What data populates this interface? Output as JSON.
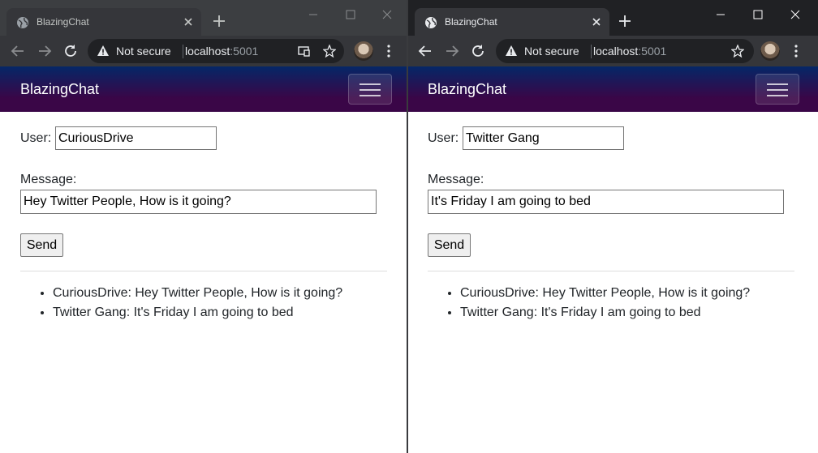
{
  "left_window": {
    "tab_title": "BlazingChat",
    "address": {
      "security_label": "Not secure",
      "host": "localhost",
      "port": ":5001"
    },
    "page": {
      "brand": "BlazingChat",
      "user_label": "User:",
      "user_value": "CuriousDrive",
      "message_label": "Message:",
      "message_value": "Hey Twitter People, How is it going?",
      "send_label": "Send",
      "messages": [
        "CuriousDrive: Hey Twitter People, How is it going?",
        "Twitter Gang: It's Friday I am going to bed"
      ]
    }
  },
  "right_window": {
    "tab_title": "BlazingChat",
    "address": {
      "security_label": "Not secure",
      "host": "localhost",
      "port": ":5001"
    },
    "page": {
      "brand": "BlazingChat",
      "user_label": "User:",
      "user_value": "Twitter Gang",
      "message_label": "Message:",
      "message_value": "It's Friday I am going to bed",
      "send_label": "Send",
      "messages": [
        "CuriousDrive: Hey Twitter People, How is it going?",
        "Twitter Gang: It's Friday I am going to bed"
      ]
    }
  },
  "colors": {
    "navbar_gradient_top": "#052767",
    "navbar_gradient_bottom": "#3a0647",
    "chrome_dark": "#202124",
    "chrome_toolbar": "#35363a"
  }
}
